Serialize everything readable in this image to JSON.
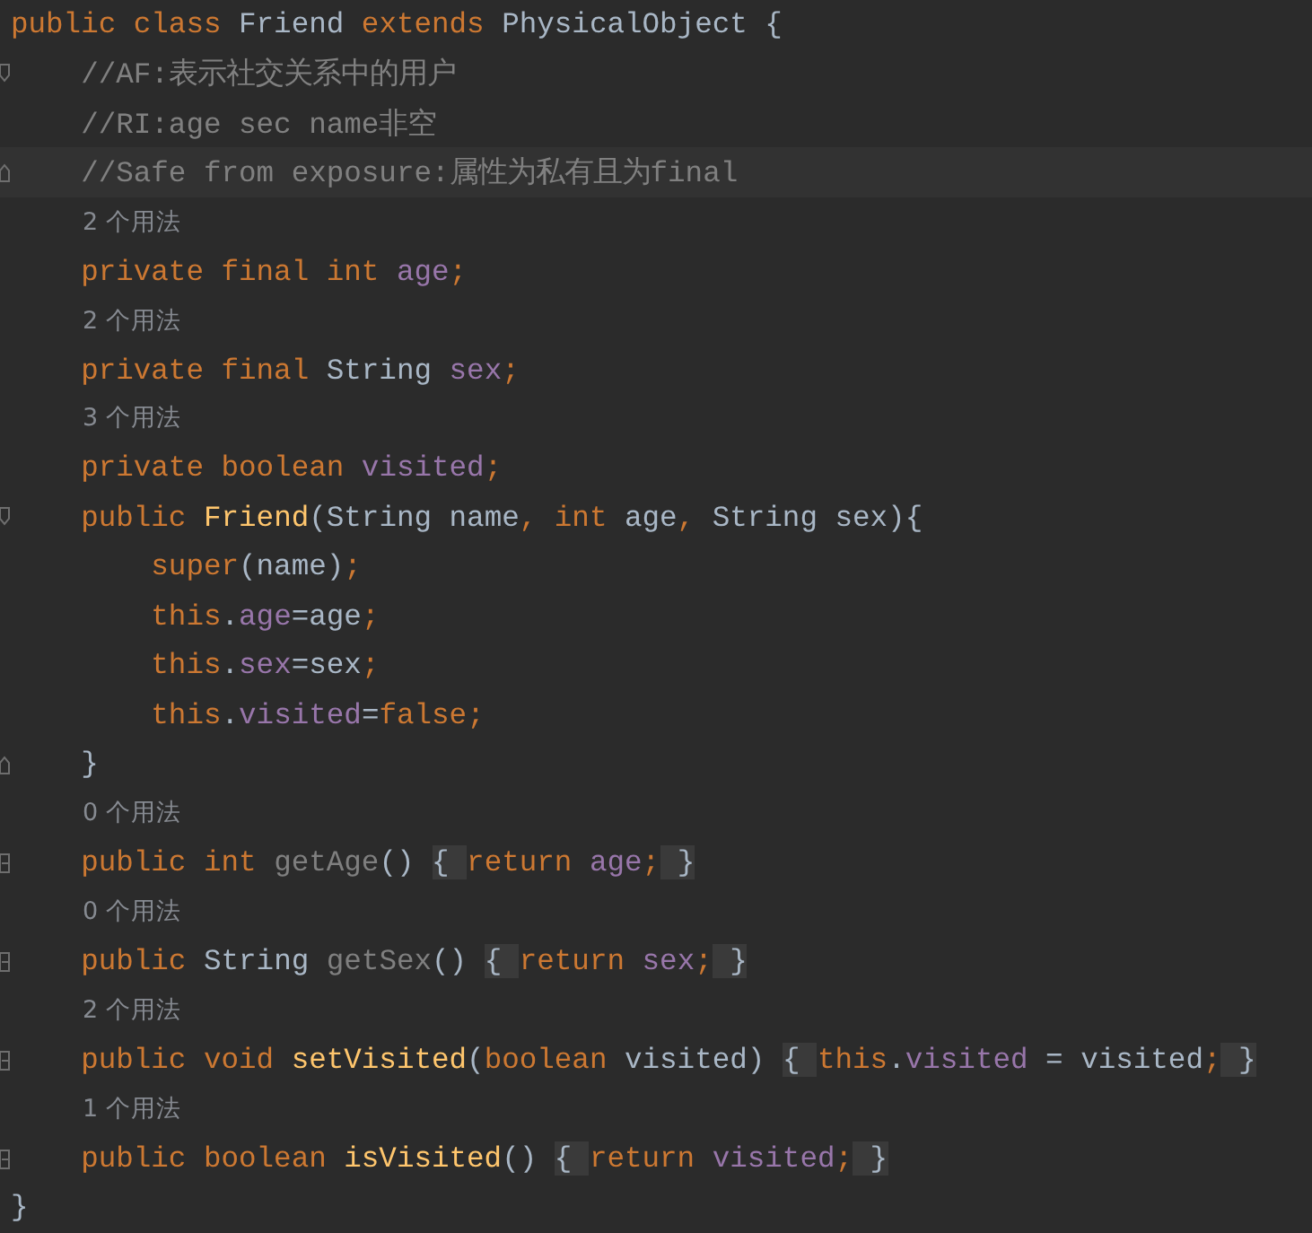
{
  "editor": {
    "lines": [
      {
        "kind": "code",
        "tokens": [
          {
            "t": "public class ",
            "kind": "keyword"
          },
          {
            "t": "Friend ",
            "kind": "plain"
          },
          {
            "t": "extends ",
            "kind": "keyword"
          },
          {
            "t": "PhysicalObject {",
            "kind": "plain"
          }
        ]
      },
      {
        "kind": "code",
        "fold_marker": {
          "kind": "start"
        },
        "tokens": [
          {
            "t": "    //AF:表示社交关系中的用户",
            "kind": "comment"
          }
        ]
      },
      {
        "kind": "code",
        "tokens": [
          {
            "t": "    //RI:age sec name非空",
            "kind": "comment"
          }
        ]
      },
      {
        "kind": "code",
        "fold_marker": {
          "kind": "end"
        },
        "current": true,
        "tokens": [
          {
            "t": "    //Safe from exposure:属性为私有且为final",
            "kind": "comment"
          }
        ]
      },
      {
        "kind": "hint",
        "text": "2 个用法"
      },
      {
        "kind": "code",
        "tokens": [
          {
            "t": "    private final int ",
            "kind": "keyword"
          },
          {
            "t": "age",
            "kind": "field"
          },
          {
            "t": ";",
            "kind": "keyword"
          }
        ]
      },
      {
        "kind": "hint",
        "text": "2 个用法"
      },
      {
        "kind": "code",
        "tokens": [
          {
            "t": "    private final ",
            "kind": "keyword"
          },
          {
            "t": "String ",
            "kind": "plain"
          },
          {
            "t": "sex",
            "kind": "field"
          },
          {
            "t": ";",
            "kind": "keyword"
          }
        ]
      },
      {
        "kind": "hint",
        "text": "3 个用法"
      },
      {
        "kind": "code",
        "tokens": [
          {
            "t": "    private boolean ",
            "kind": "keyword"
          },
          {
            "t": "visited",
            "kind": "field"
          },
          {
            "t": ";",
            "kind": "keyword"
          }
        ]
      },
      {
        "kind": "code",
        "fold_marker": {
          "kind": "start"
        },
        "tokens": [
          {
            "t": "    public ",
            "kind": "keyword"
          },
          {
            "t": "Friend",
            "kind": "declaration"
          },
          {
            "t": "(String name",
            "kind": "plain"
          },
          {
            "t": ", int ",
            "kind": "keyword"
          },
          {
            "t": "age",
            "kind": "plain"
          },
          {
            "t": ", ",
            "kind": "keyword"
          },
          {
            "t": "String sex){",
            "kind": "plain"
          }
        ]
      },
      {
        "kind": "code",
        "tokens": [
          {
            "t": "        super",
            "kind": "keyword"
          },
          {
            "t": "(name)",
            "kind": "plain"
          },
          {
            "t": ";",
            "kind": "keyword"
          }
        ]
      },
      {
        "kind": "code",
        "tokens": [
          {
            "t": "        this",
            "kind": "keyword"
          },
          {
            "t": ".",
            "kind": "plain"
          },
          {
            "t": "age",
            "kind": "field"
          },
          {
            "t": "=age",
            "kind": "plain"
          },
          {
            "t": ";",
            "kind": "keyword"
          }
        ]
      },
      {
        "kind": "code",
        "tokens": [
          {
            "t": "        this",
            "kind": "keyword"
          },
          {
            "t": ".",
            "kind": "plain"
          },
          {
            "t": "sex",
            "kind": "field"
          },
          {
            "t": "=sex",
            "kind": "plain"
          },
          {
            "t": ";",
            "kind": "keyword"
          }
        ]
      },
      {
        "kind": "code",
        "tokens": [
          {
            "t": "        this",
            "kind": "keyword"
          },
          {
            "t": ".",
            "kind": "plain"
          },
          {
            "t": "visited",
            "kind": "field"
          },
          {
            "t": "=",
            "kind": "plain"
          },
          {
            "t": "false;",
            "kind": "keyword"
          }
        ]
      },
      {
        "kind": "code",
        "fold_marker": {
          "kind": "end"
        },
        "tokens": [
          {
            "t": "    }",
            "kind": "plain"
          }
        ]
      },
      {
        "kind": "hint",
        "text": "0 个用法"
      },
      {
        "kind": "code",
        "fold_marker": {
          "kind": "collapsed"
        },
        "tokens": [
          {
            "t": "    public int ",
            "kind": "keyword"
          },
          {
            "t": "getAge",
            "kind": "unused"
          },
          {
            "t": "() ",
            "kind": "plain"
          },
          {
            "t": "{ ",
            "kind": "folded"
          },
          {
            "t": "return ",
            "kind": "keyword"
          },
          {
            "t": "age",
            "kind": "field"
          },
          {
            "t": ";",
            "kind": "keyword"
          },
          {
            "t": " }",
            "kind": "folded"
          }
        ]
      },
      {
        "kind": "hint",
        "text": "0 个用法"
      },
      {
        "kind": "code",
        "fold_marker": {
          "kind": "collapsed"
        },
        "tokens": [
          {
            "t": "    public ",
            "kind": "keyword"
          },
          {
            "t": "String ",
            "kind": "plain"
          },
          {
            "t": "getSex",
            "kind": "unused"
          },
          {
            "t": "() ",
            "kind": "plain"
          },
          {
            "t": "{ ",
            "kind": "folded"
          },
          {
            "t": "return ",
            "kind": "keyword"
          },
          {
            "t": "sex",
            "kind": "field"
          },
          {
            "t": ";",
            "kind": "keyword"
          },
          {
            "t": " }",
            "kind": "folded"
          }
        ]
      },
      {
        "kind": "hint",
        "text": "2 个用法"
      },
      {
        "kind": "code",
        "fold_marker": {
          "kind": "collapsed"
        },
        "tokens": [
          {
            "t": "    public void ",
            "kind": "keyword"
          },
          {
            "t": "setVisited",
            "kind": "declaration"
          },
          {
            "t": "(",
            "kind": "plain"
          },
          {
            "t": "boolean ",
            "kind": "keyword"
          },
          {
            "t": "visited) ",
            "kind": "plain"
          },
          {
            "t": "{ ",
            "kind": "folded"
          },
          {
            "t": "this",
            "kind": "keyword"
          },
          {
            "t": ".",
            "kind": "plain"
          },
          {
            "t": "visited",
            "kind": "field"
          },
          {
            "t": " = visited",
            "kind": "plain"
          },
          {
            "t": ";",
            "kind": "keyword"
          },
          {
            "t": " }",
            "kind": "folded"
          }
        ]
      },
      {
        "kind": "hint",
        "text": "1 个用法"
      },
      {
        "kind": "code",
        "fold_marker": {
          "kind": "collapsed"
        },
        "tokens": [
          {
            "t": "    public boolean ",
            "kind": "keyword"
          },
          {
            "t": "isVisited",
            "kind": "declaration"
          },
          {
            "t": "() ",
            "kind": "plain"
          },
          {
            "t": "{ ",
            "kind": "folded"
          },
          {
            "t": "return ",
            "kind": "keyword"
          },
          {
            "t": "visited",
            "kind": "field"
          },
          {
            "t": ";",
            "kind": "keyword"
          },
          {
            "t": " }",
            "kind": "folded"
          }
        ]
      },
      {
        "kind": "code",
        "tokens": [
          {
            "t": "}",
            "kind": "plain"
          }
        ]
      }
    ]
  }
}
